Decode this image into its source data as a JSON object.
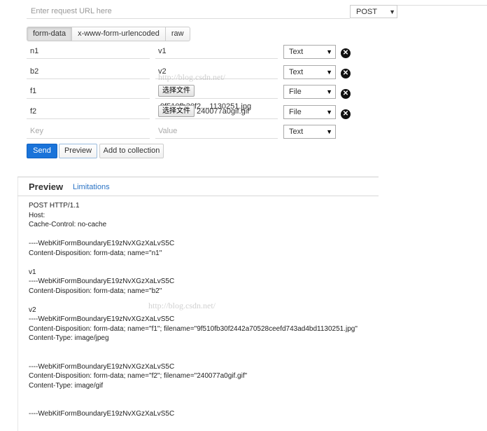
{
  "request": {
    "url_placeholder": "Enter request URL here",
    "url_value": "",
    "method": "POST"
  },
  "body_tabs": [
    {
      "label": "form-data",
      "active": true
    },
    {
      "label": "x-www-form-urlencoded",
      "active": false
    },
    {
      "label": "raw",
      "active": false
    }
  ],
  "params": [
    {
      "key": "n1",
      "value": "v1",
      "type": "Text"
    },
    {
      "key": "b2",
      "value": "v2",
      "type": "Text"
    },
    {
      "key": "f1",
      "file_button": "选择文件",
      "file_name": "9f510fb30f2....1130251.jpg",
      "type": "File"
    },
    {
      "key": "f2",
      "file_button": "选择文件",
      "file_name": "240077a0gif.gif",
      "type": "File"
    }
  ],
  "new_param": {
    "key_placeholder": "Key",
    "value_placeholder": "Value",
    "type": "Text"
  },
  "actions": {
    "send": "Send",
    "preview": "Preview",
    "add_to_collection": "Add to collection"
  },
  "preview": {
    "title": "Preview",
    "limitations": "Limitations",
    "lines": [
      "POST HTTP/1.1",
      "Host:",
      "Cache-Control: no-cache",
      "",
      "----WebKitFormBoundaryE19zNvXGzXaLvS5C",
      "Content-Disposition: form-data; name=\"n1\"",
      "",
      "v1",
      "----WebKitFormBoundaryE19zNvXGzXaLvS5C",
      "Content-Disposition: form-data; name=\"b2\"",
      "",
      "v2",
      "----WebKitFormBoundaryE19zNvXGzXaLvS5C",
      "Content-Disposition: form-data; name=\"f1\"; filename=\"9f510fb30f2442a70528ceefd743ad4bd1130251.jpg\"",
      "Content-Type: image/jpeg",
      "",
      "",
      "----WebKitFormBoundaryE19zNvXGzXaLvS5C",
      "Content-Disposition: form-data; name=\"f2\"; filename=\"240077a0gif.gif\"",
      "Content-Type: image/gif",
      "",
      "",
      "----WebKitFormBoundaryE19zNvXGzXaLvS5C"
    ]
  },
  "watermarks": [
    "http://blog.csdn.net/",
    "http://blog.csdn.net/"
  ],
  "colors": {
    "send_button": "#1a73d9",
    "link": "#2a73c5"
  }
}
